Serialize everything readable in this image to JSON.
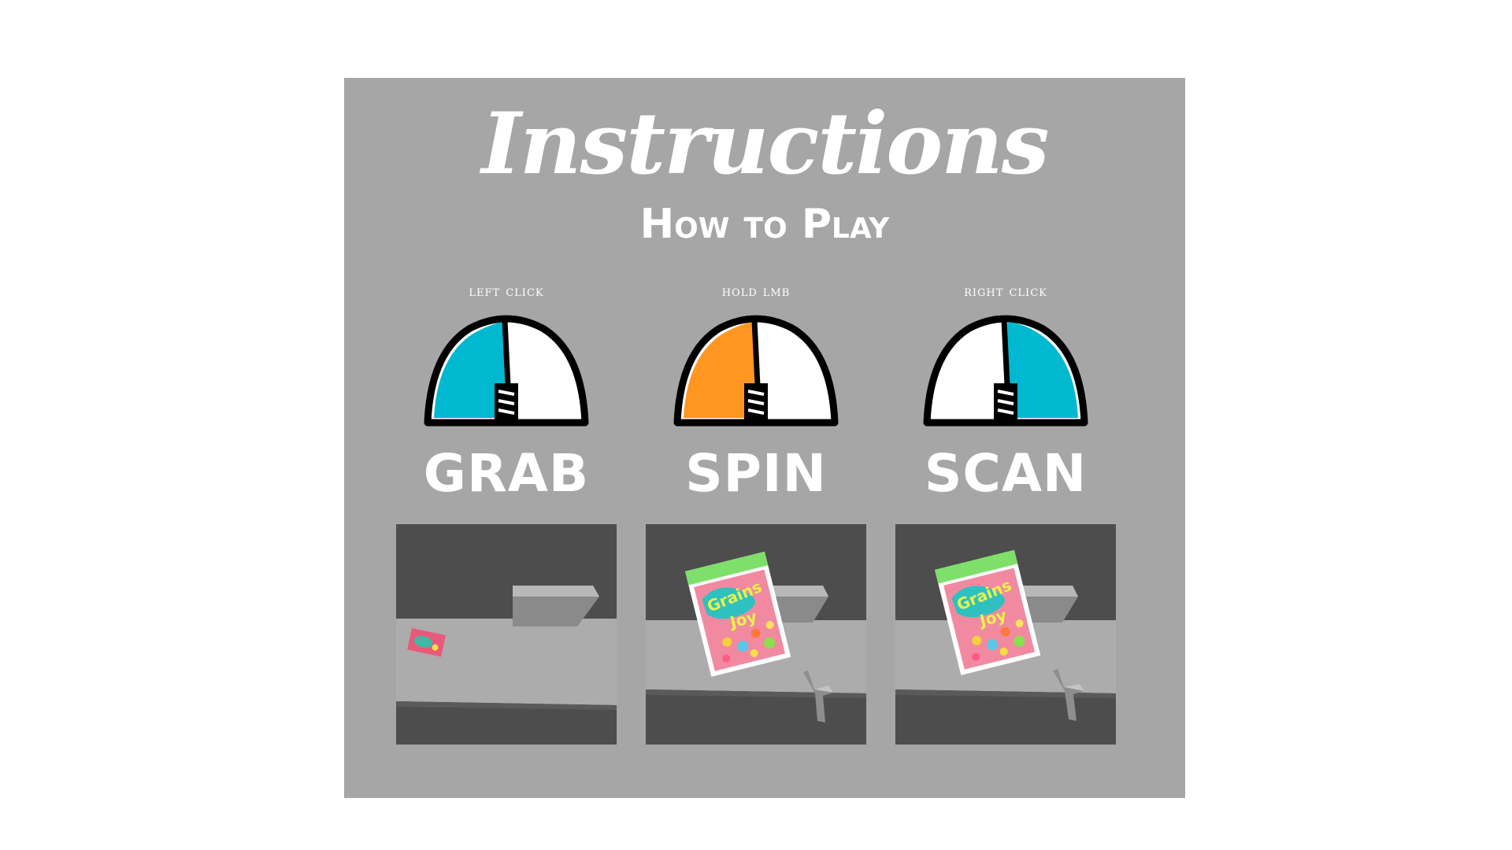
{
  "title": "Instructions",
  "subtitle": "How to Play",
  "controls": [
    {
      "input_label": "left click",
      "action": "GRAB",
      "highlight": "left",
      "highlight_color": "#00b8d0",
      "object": "small-box-on-floor"
    },
    {
      "input_label": "hold lmb",
      "action": "SPIN",
      "highlight": "left",
      "highlight_color": "#ff9620",
      "object": "cereal-box-held"
    },
    {
      "input_label": "right click",
      "action": "SCAN",
      "highlight": "right",
      "highlight_color": "#00b8d0",
      "object": "cereal-box-held"
    }
  ],
  "colors": {
    "panel": "#a6a6a6",
    "text": "#ffffff",
    "outline": "#000000"
  }
}
